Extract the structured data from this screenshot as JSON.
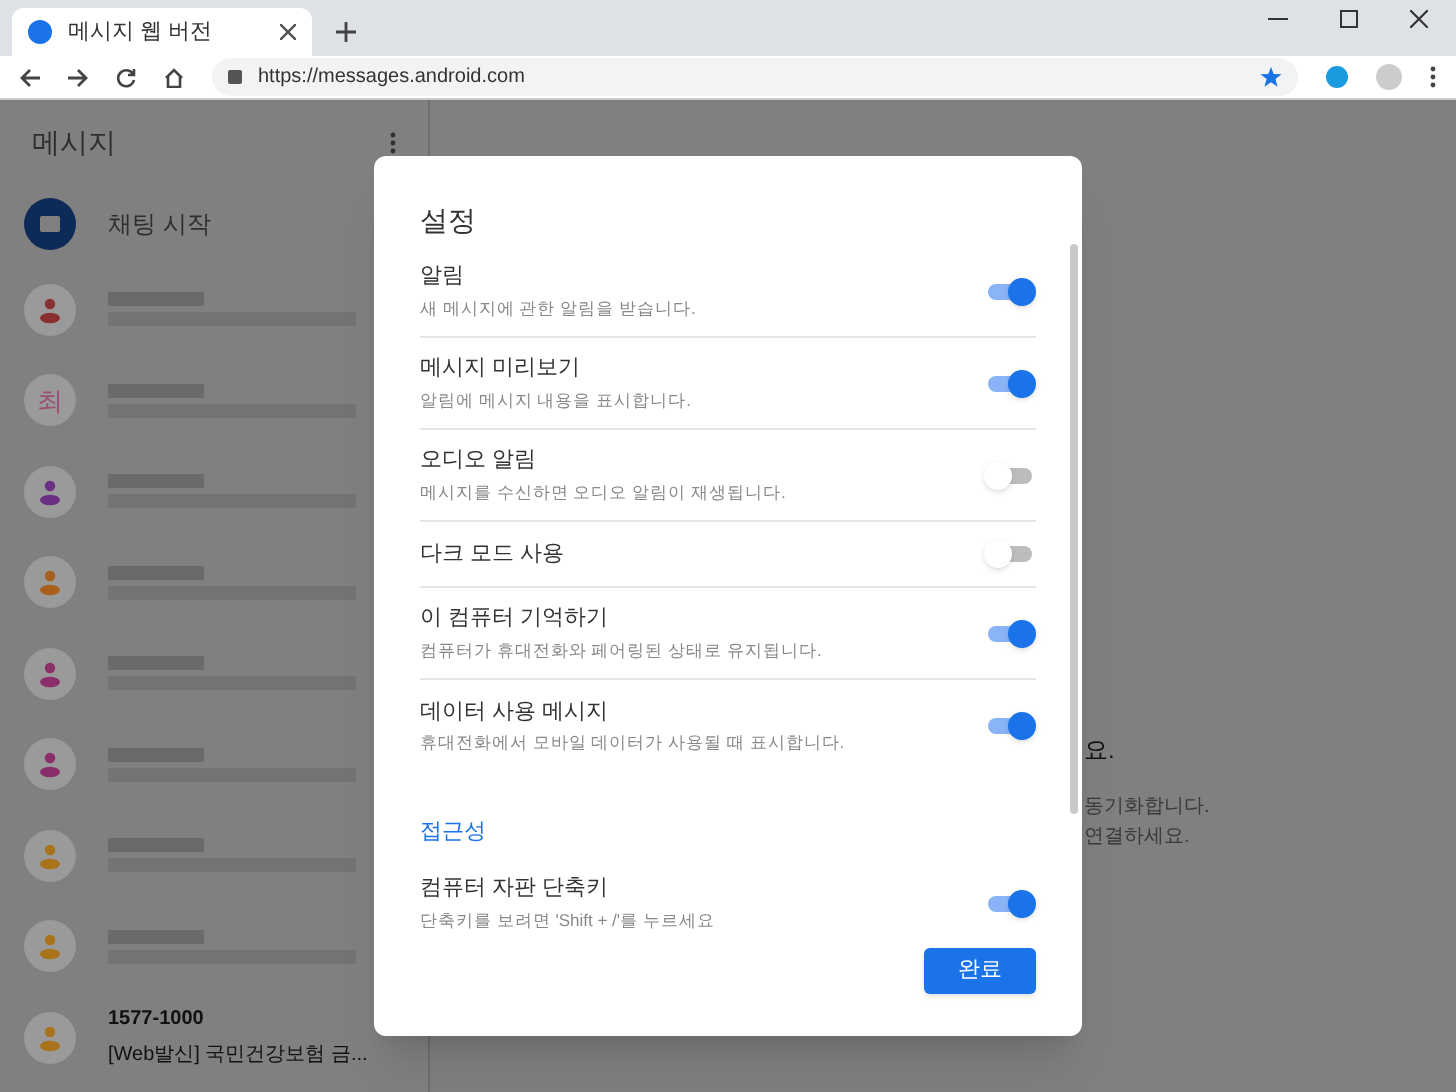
{
  "browser": {
    "tab_title": "메시지 웹 버전",
    "url": "https://messages.android.com"
  },
  "sidebar": {
    "title": "메시지",
    "start_chat": "채팅 시작",
    "conversations": [
      {
        "kind": "blurred",
        "color": "#8a2f2f"
      },
      {
        "kind": "blurred",
        "letter": "최",
        "color": "#9a4f72"
      },
      {
        "kind": "blurred",
        "color": "#6a2f82"
      },
      {
        "kind": "blurred",
        "color": "#a8601c"
      },
      {
        "kind": "blurred",
        "color": "#8a2e6a"
      },
      {
        "kind": "blurred",
        "color": "#8a2e6a"
      },
      {
        "kind": "blurred",
        "color": "#a8731a"
      },
      {
        "kind": "blurred",
        "color": "#a8731a"
      },
      {
        "kind": "text",
        "color": "#a8731a",
        "name": "1577-1000",
        "snippet": "[Web발신] 국민건강보험 금..."
      }
    ]
  },
  "background_texts": [
    "요.",
    "동기화합니다.",
    "연결하세요."
  ],
  "dialog": {
    "title": "설정",
    "settings": [
      {
        "kind": "toggle",
        "label": "알림",
        "description": "새 메시지에 관한 알림을 받습니다.",
        "on": true
      },
      {
        "kind": "toggle",
        "label": "메시지 미리보기",
        "description": "알림에 메시지 내용을 표시합니다.",
        "on": true
      },
      {
        "kind": "toggle",
        "label": "오디오 알림",
        "description": "메시지를 수신하면 오디오 알림이 재생됩니다.",
        "on": false
      },
      {
        "kind": "toggle",
        "label": "다크 모드 사용",
        "on": false
      },
      {
        "kind": "toggle",
        "label": "이 컴퓨터 기억하기",
        "description": "컴퓨터가 휴대전화와 페어링된 상태로 유지됩니다.",
        "on": true
      },
      {
        "kind": "toggle",
        "label": "데이터 사용 메시지",
        "description": "휴대전화에서 모바일 데이터가 사용될 때 표시합니다.",
        "on": true
      },
      {
        "kind": "heading",
        "label": "접근성"
      },
      {
        "kind": "toggle",
        "label": "컴퓨터 자판 단축키",
        "description": "단축키를 보려면 'Shift + /'를 누르세요",
        "on": true
      }
    ],
    "done_button": "완료"
  }
}
